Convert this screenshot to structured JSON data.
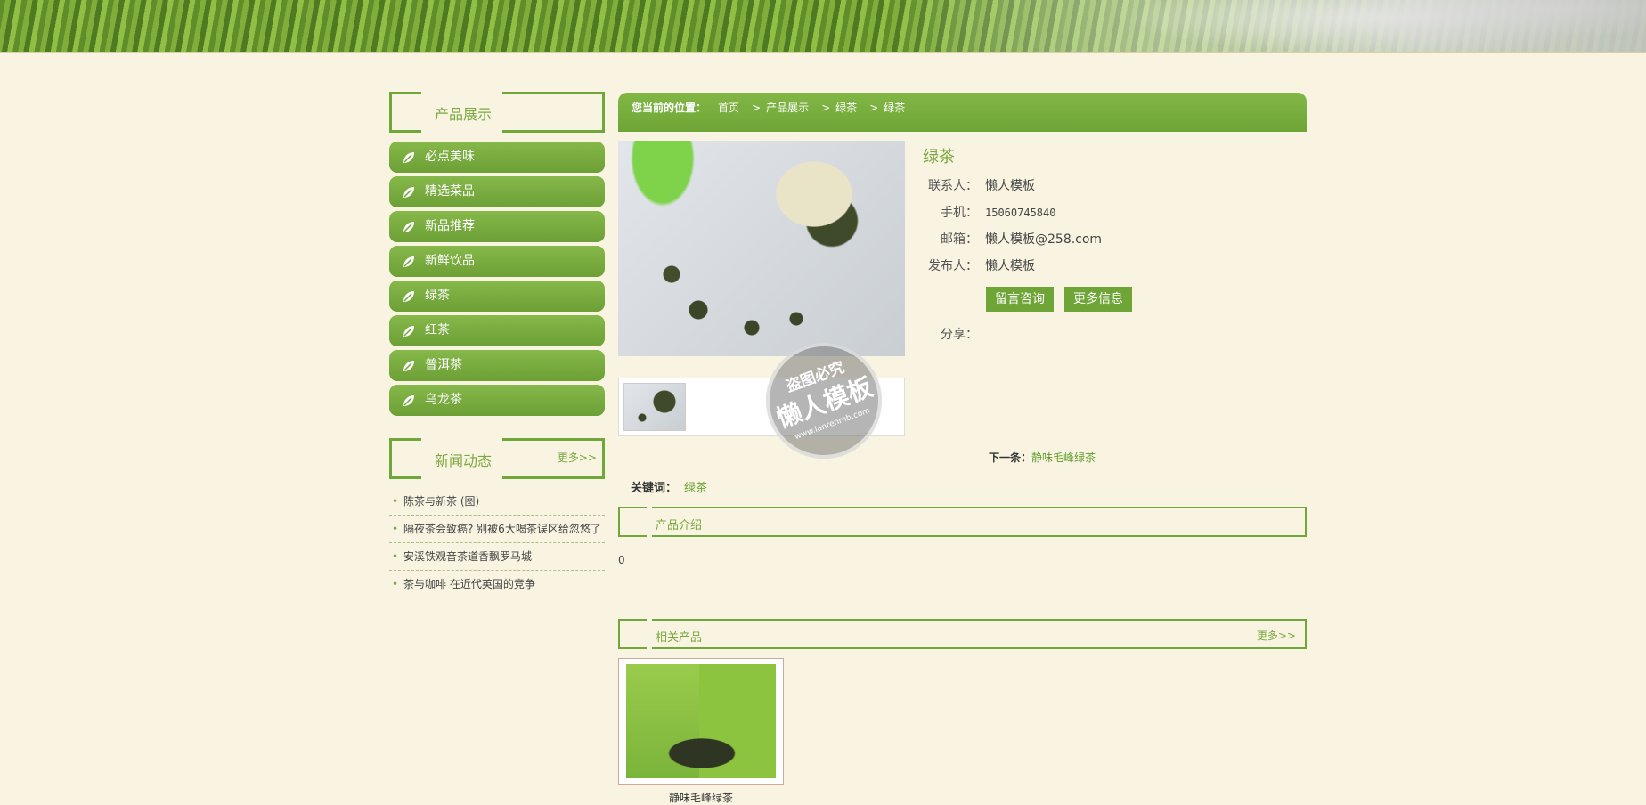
{
  "sidebar": {
    "product_title": "产品展示",
    "categories": [
      "必点美味",
      "精选菜品",
      "新品推荐",
      "新鲜饮品",
      "绿茶",
      "红茶",
      "普洱茶",
      "乌龙茶"
    ],
    "news_title": "新闻动态",
    "news_more": "更多>>",
    "news": [
      "陈茶与新茶 (图)",
      "隔夜茶会致癌? 别被6大喝茶误区给忽悠了",
      "安溪铁观音茶道香飘罗马城",
      "茶与咖啡 在近代英国的竞争"
    ]
  },
  "breadcrumb": {
    "label": "您当前的位置：",
    "items": [
      "首页",
      "产品展示",
      "绿茶",
      "绿茶"
    ],
    "separator": ">"
  },
  "product": {
    "title": "绿茶",
    "contact_label": "联系人：",
    "contact": "懒人模板",
    "phone_label": "手机：",
    "phone": "15060745840",
    "email_label": "邮箱：",
    "email": "懒人模板@258.com",
    "publisher_label": "发布人：",
    "publisher": "懒人模板",
    "btn_message": "留言咨询",
    "btn_more": "更多信息",
    "share_label": "分享："
  },
  "watermark": {
    "line1": "盗图必究",
    "line2": "懒人模板",
    "line3": "www.lanrenmb.com"
  },
  "navigation": {
    "next_label": "下一条：",
    "next_title": "静味毛峰绿茶"
  },
  "keywords": {
    "label": "关键词：",
    "value": "绿茶"
  },
  "intro": {
    "title": "产品介绍",
    "body": "0"
  },
  "related": {
    "title": "相关产品",
    "more": "更多>>",
    "items": [
      {
        "name": "静味毛峰绿茶"
      }
    ]
  },
  "colors": {
    "accent": "#70a73a",
    "background": "#f8f4e1"
  }
}
